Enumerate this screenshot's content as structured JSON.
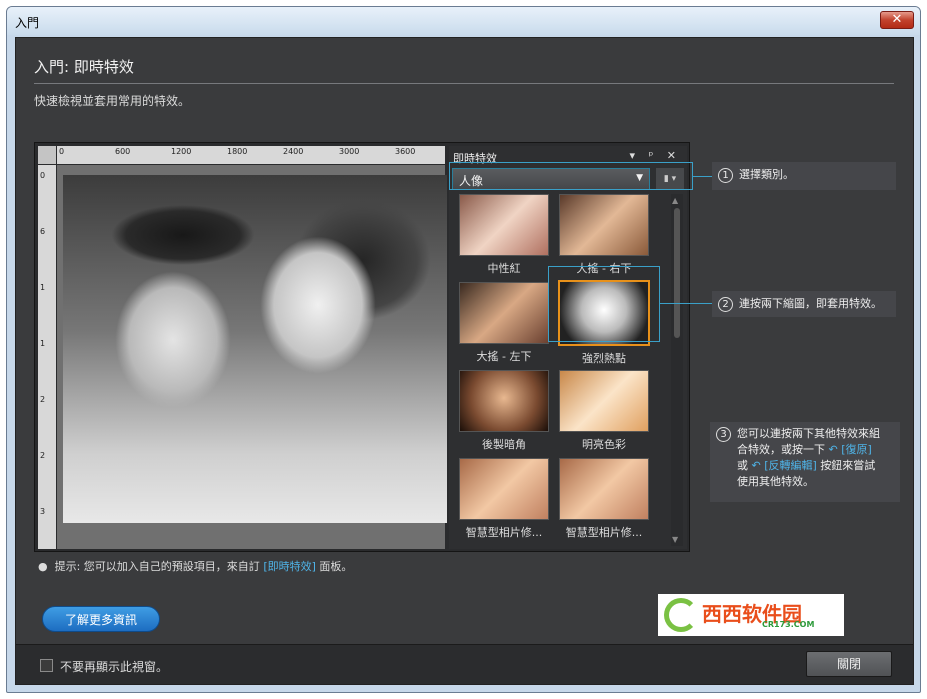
{
  "window": {
    "title": "入門",
    "close_glyph": "✕"
  },
  "header": {
    "title": "入門: 即時特效",
    "subtitle": "快速檢視並套用常用的特效。"
  },
  "ruler": {
    "top_labels": [
      "0",
      "600",
      "1200",
      "1800",
      "2400",
      "3000",
      "3600"
    ],
    "left_labels": [
      "0",
      "6",
      "1",
      "1",
      "2",
      "2",
      "3"
    ]
  },
  "panel": {
    "title": "即時特效",
    "controls": "▾ ᵖ ✕",
    "category": "人像",
    "thumbnails": [
      {
        "label": "中性紅"
      },
      {
        "label": "大搖 - 右下"
      },
      {
        "label": "大搖 - 左下"
      },
      {
        "label": "強烈熱點",
        "selected": true
      },
      {
        "label": "後製暗角"
      },
      {
        "label": "明亮色彩"
      },
      {
        "label": "智慧型相片修..."
      },
      {
        "label": "智慧型相片修..."
      }
    ]
  },
  "callouts": {
    "c1": {
      "num": "1",
      "text": "選擇類別。"
    },
    "c2": {
      "num": "2",
      "text": "連按兩下縮圖，即套用特效。"
    },
    "c3": {
      "num": "3",
      "line1": "您可以連按兩下其他特效來組",
      "line2": "合特效，或按一下",
      "undo": "[復原]",
      "line3_pre": "或",
      "redo": "[反轉編輯]",
      "line3_post": "按鈕來嘗試",
      "line4": "使用其他特效。"
    }
  },
  "hint": {
    "bullet": "●",
    "prefix": "提示: 您可以加入自己的預設項目，來自訂",
    "link": "[即時特效]",
    "suffix": "面板。"
  },
  "buttons": {
    "learn_more": "了解更多資訊",
    "close": "關閉"
  },
  "footer": {
    "checkbox_label": "不要再顯示此視窗。"
  },
  "logo": {
    "text": "西西软件园",
    "sub": "CR173.COM"
  },
  "colors": {
    "accent_blue": "#3aa0c8",
    "selection_orange": "#e8911a",
    "button_blue": "#1d6dc1"
  }
}
